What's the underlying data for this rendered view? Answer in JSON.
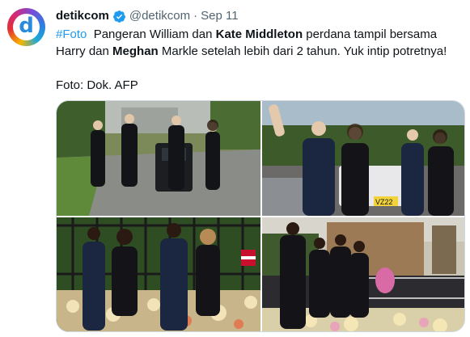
{
  "author": {
    "avatar_letter": "d",
    "name": "detikcom",
    "handle": "@detikcom",
    "separator": "·",
    "date": "Sep 11"
  },
  "tweet": {
    "hashtag": "#Foto",
    "t1": "Pangeran William dan ",
    "b1": "Kate Middleton",
    "t2": " perdana tampil bersama Harry dan ",
    "b2": "Meghan",
    "t3": " Markle setelah lebih dari 2 tahun. Yuk intip potretnya!",
    "credit": "Foto: Dok. AFP"
  },
  "photos": [
    {
      "alt": "photo-1"
    },
    {
      "alt": "photo-2"
    },
    {
      "alt": "photo-3"
    },
    {
      "alt": "photo-4"
    }
  ],
  "colors": {
    "verified": "#1d9bf0",
    "hashtag": "#1d9bf0",
    "muted": "#536471",
    "sign_text": "VZ22"
  }
}
